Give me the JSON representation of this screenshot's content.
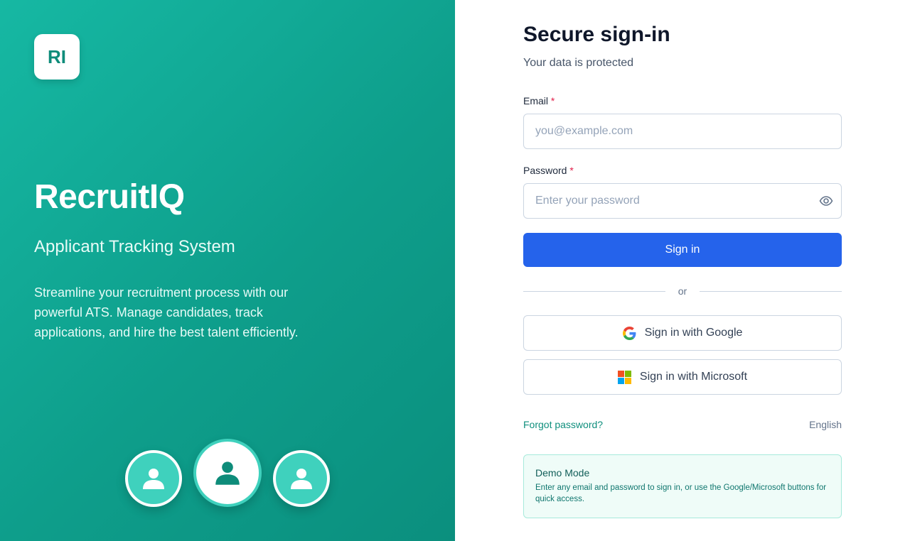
{
  "brand": {
    "logo_text": "RI",
    "name": "RecruitIQ",
    "tagline": "Applicant Tracking System",
    "description": "Streamline your recruitment process with our powerful ATS. Manage candidates, track applications, and hire the best talent efficiently."
  },
  "avatars": [
    "user-icon",
    "user-icon",
    "user-icon"
  ],
  "form": {
    "title": "Secure sign-in",
    "subtitle": "Your data is protected",
    "email_label": "Email",
    "email_placeholder": "you@example.com",
    "email_value": "",
    "password_label": "Password",
    "password_placeholder": "Enter your password",
    "password_value": "",
    "required_marker": "*",
    "sign_in_label": "Sign in",
    "divider_text": "or",
    "google_label": "Sign in with Google",
    "microsoft_label": "Sign in with Microsoft",
    "forgot_label": "Forgot password?",
    "language": "English"
  },
  "demo": {
    "title": "Demo Mode",
    "text": "Enter any email and password to sign in, or use the Google/Microsoft buttons for quick access."
  },
  "colors": {
    "accent_teal": "#14b8a6",
    "primary_blue": "#2563eb",
    "required_red": "#e11d48"
  }
}
